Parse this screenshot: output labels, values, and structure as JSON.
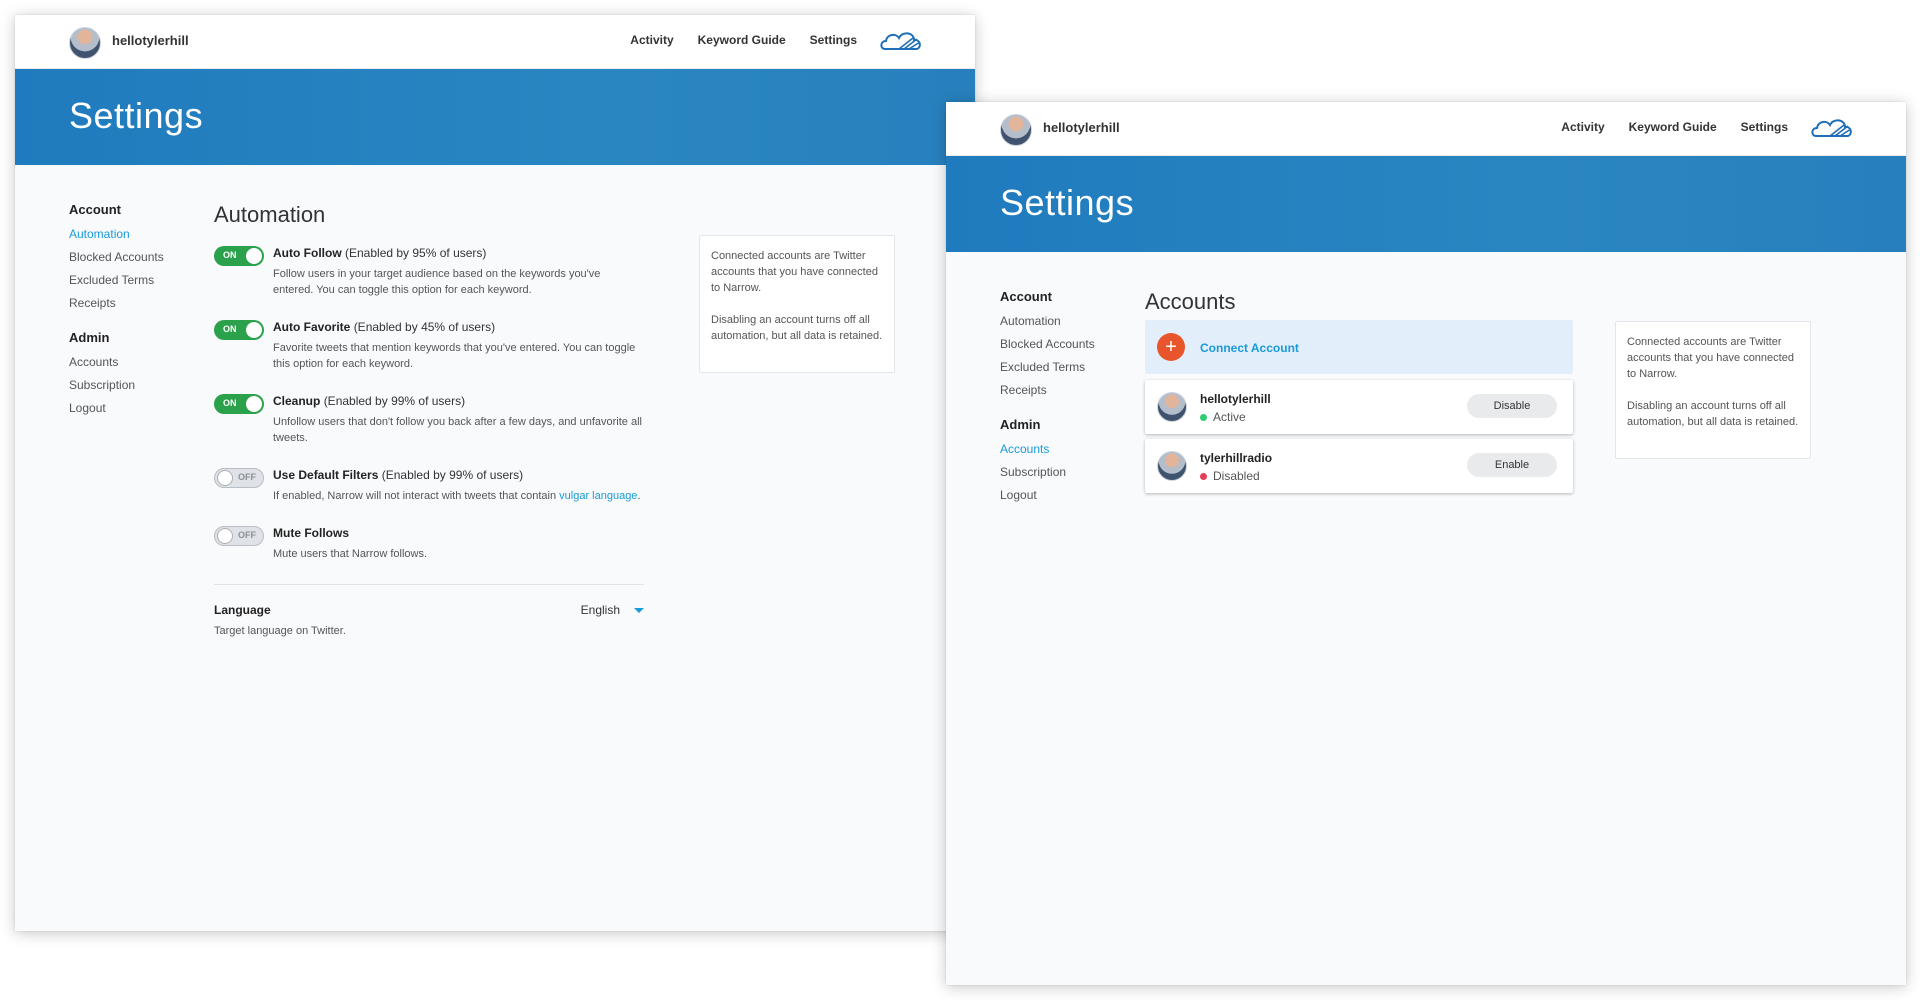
{
  "colors": {
    "brand_blue": "#1f7bbd",
    "accent_link": "#1a9ad6",
    "toggle_on": "#2aa14a",
    "connect_button": "#e8542b",
    "status_active": "#2ecc71",
    "status_disabled": "#e53c5a"
  },
  "window1": {
    "username": "hellotylerhill",
    "nav": [
      "Activity",
      "Keyword Guide",
      "Settings"
    ],
    "logo_icon": "cloud-logo-icon",
    "banner_title": "Settings",
    "sidebar": {
      "account_heading": "Account",
      "account_items": [
        "Automation",
        "Blocked Accounts",
        "Excluded Terms",
        "Receipts"
      ],
      "admin_heading": "Admin",
      "admin_items": [
        "Accounts",
        "Subscription",
        "Logout"
      ],
      "active_item": "Automation"
    },
    "section_title": "Automation",
    "settings": [
      {
        "toggle": "ON",
        "name": "Auto Follow",
        "note": "(Enabled by 95% of users)",
        "desc": "Follow users in your target audience based on the keywords you've entered. You can toggle this option for each keyword."
      },
      {
        "toggle": "ON",
        "name": "Auto Favorite",
        "note": "(Enabled by 45% of users)",
        "desc": "Favorite tweets that mention keywords that you've entered. You can toggle this option for each keyword."
      },
      {
        "toggle": "ON",
        "name": "Cleanup",
        "note": "(Enabled by 99% of users)",
        "desc": "Unfollow users that don't follow you back after a few days, and unfavorite all tweets."
      },
      {
        "toggle": "OFF",
        "name": "Use Default Filters",
        "note": "(Enabled by 99% of users)",
        "desc_prefix": "If enabled, Narrow will not interact with tweets that contain ",
        "desc_link": "vulgar language",
        "desc_suffix": "."
      },
      {
        "toggle": "OFF",
        "name": "Mute Follows",
        "note": "",
        "desc": "Mute users that Narrow follows."
      }
    ],
    "language": {
      "label": "Language",
      "desc": "Target language on Twitter.",
      "value": "English"
    },
    "info": [
      "Connected accounts are Twitter accounts that you have connected to Narrow.",
      "Disabling an account turns off all automation, but all data is retained."
    ]
  },
  "window2": {
    "username": "hellotylerhill",
    "nav": [
      "Activity",
      "Keyword Guide",
      "Settings"
    ],
    "logo_icon": "cloud-logo-icon",
    "banner_title": "Settings",
    "sidebar": {
      "account_heading": "Account",
      "account_items": [
        "Automation",
        "Blocked Accounts",
        "Excluded Terms",
        "Receipts"
      ],
      "admin_heading": "Admin",
      "admin_items": [
        "Accounts",
        "Subscription",
        "Logout"
      ],
      "active_item": "Accounts"
    },
    "section_title": "Accounts",
    "connect_label": "Connect Account",
    "accounts": [
      {
        "name": "hellotylerhill",
        "status": "Active",
        "button": "Disable"
      },
      {
        "name": "tylerhillradio",
        "status": "Disabled",
        "button": "Enable"
      }
    ],
    "info": [
      "Connected accounts are Twitter accounts that you have connected to Narrow.",
      "Disabling an account turns off all automation, but all data is retained."
    ]
  }
}
